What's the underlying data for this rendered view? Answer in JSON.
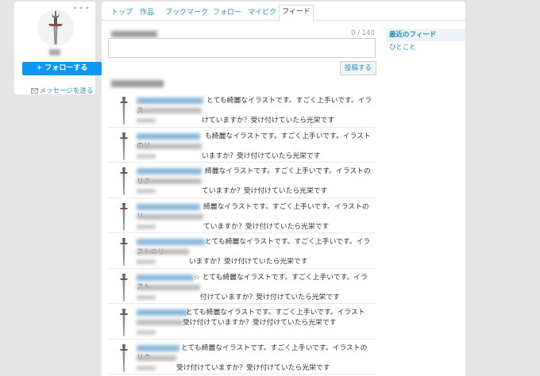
{
  "profile": {
    "follow_label": "+ フォローする",
    "message_label": "メッセージを送る",
    "more_icon": "more-dots-icon"
  },
  "tabs": [
    {
      "label": "トップ"
    },
    {
      "label": "作品"
    },
    {
      "label": "ブックマーク"
    },
    {
      "label": "フォロー"
    },
    {
      "label": "マイピク"
    },
    {
      "label": "フィード",
      "active": true
    }
  ],
  "composer": {
    "char_count": "0 / 140",
    "post_label": "投稿する"
  },
  "sidebar": {
    "items": [
      {
        "label": "最近のフィード",
        "active": true
      },
      {
        "label": "ひとこと"
      }
    ]
  },
  "feed": [
    {
      "text": "とても綺麗なイラストです。すごく上手いです。イラス",
      "text2": "けていますか？受け付けていたら光栄です"
    },
    {
      "text": "も綺麗なイラストです。すごく上手いです。イラストのリ",
      "text2": "いますか？受け付けていたら光栄です"
    },
    {
      "text": "綺麗なイラストです。すごく上手いです。イラストのリク",
      "text2": "ていますか？受け付けていたら光栄です"
    },
    {
      "text": "綺麗なイラストです。すごく上手いです。イラストのリ",
      "text2": "ていますか？受け付けていたら光栄です"
    },
    {
      "text": "とても綺麗なイラストです。すごく上手いです。イラストのリ",
      "text2": "いますか？受け付けていたら光栄です"
    },
    {
      "text": "☆ とても綺麗なイラストです。すごく上手いです。イラスト",
      "text2": "付けていますか？受け付けていたら光栄です"
    },
    {
      "text": "とても綺麗なイラストです。すごく上手いです。イラスト",
      "text2": "受け付けていますか？受け付けていたら光栄です"
    },
    {
      "text": "とても綺麗なイラストです。すごく上手いです。イラストのリク",
      "text2": "受け付けていますか？受け付けていたら光栄です"
    }
  ],
  "colors": {
    "accent": "#0d96f2",
    "link": "#258fb8",
    "background": "#e4e4e4"
  }
}
